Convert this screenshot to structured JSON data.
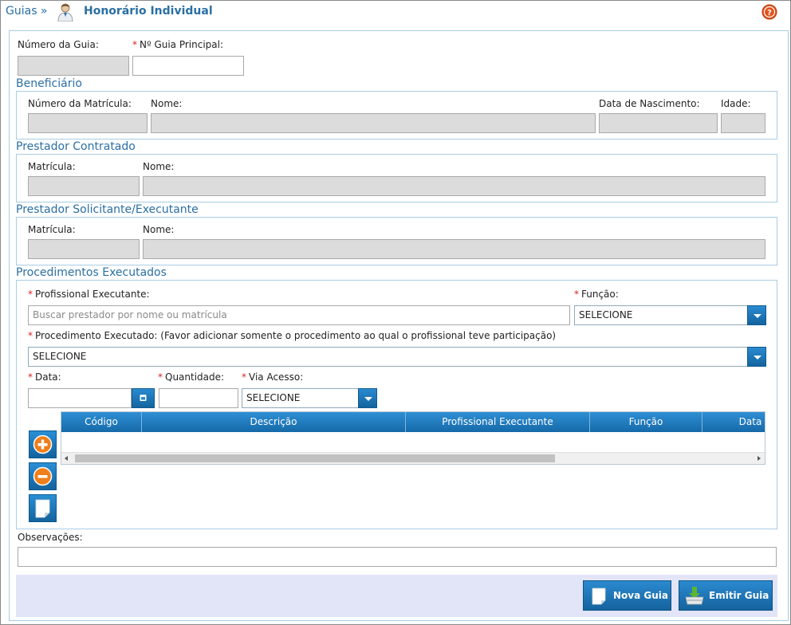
{
  "header": {
    "breadcrumb": "Guias »",
    "title": "Honorário Individual",
    "help_icon": "help-icon"
  },
  "guide": {
    "numero_label": "Número da Guia:",
    "principal_label": "Nº Guia Principal:",
    "numero_value": "",
    "principal_value": ""
  },
  "beneficiario": {
    "title": "Beneficiário",
    "matricula_label": "Número da Matrícula:",
    "nome_label": "Nome:",
    "nascimento_label": "Data de Nascimento:",
    "idade_label": "Idade:"
  },
  "prestador_contratado": {
    "title": "Prestador Contratado",
    "matricula_label": "Matrícula:",
    "nome_label": "Nome:"
  },
  "prestador_solicitante": {
    "title": "Prestador Solicitante/Executante",
    "matricula_label": "Matrícula:",
    "nome_label": "Nome:"
  },
  "procedimentos": {
    "title": "Procedimentos Executados",
    "profissional_label": "Profissional Executante:",
    "profissional_placeholder": "Buscar prestador por nome ou matrícula",
    "funcao_label": "Função:",
    "funcao_value": "SELECIONE",
    "procedimento_label": "Procedimento Executado: (Favor adicionar somente o procedimento ao qual o profissional teve participação)",
    "procedimento_value": "SELECIONE",
    "data_label": "Data:",
    "quantidade_label": "Quantidade:",
    "via_label": "Via Acesso:",
    "via_value": "SELECIONE",
    "table_columns": [
      "Código",
      "Descrição",
      "Profissional Executante",
      "Função",
      "Data"
    ]
  },
  "observacoes": {
    "label": "Observações:",
    "value": ""
  },
  "footer": {
    "nova_guia": "Nova Guia",
    "emitir_guia": "Emitir Guia"
  },
  "colors": {
    "accent": "#1a72b4",
    "section_title": "#2a6fa3",
    "required": "#d22222",
    "footer_bg": "#e2e4f7"
  }
}
